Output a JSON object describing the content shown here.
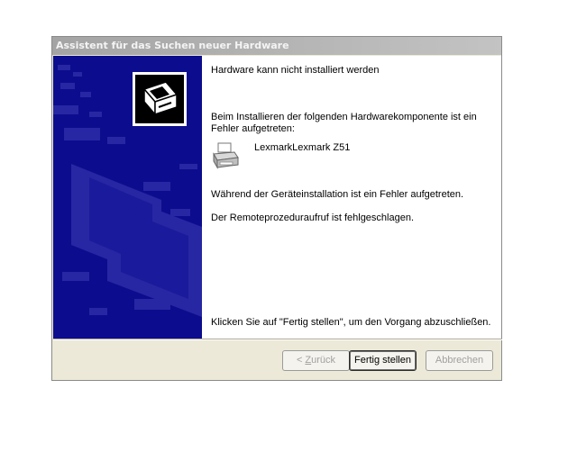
{
  "window": {
    "title": "Assistent für das Suchen neuer Hardware"
  },
  "sidebar": {
    "icon": "hardware-wizard-icon",
    "color": "#0c0c8e"
  },
  "content": {
    "heading": "Hardware kann nicht installiert werden",
    "intro": "Beim Installieren der folgenden Hardwarekomponente ist ein Fehler aufgetreten:",
    "device_icon": "printer-icon",
    "device_name": "LexmarkLexmark Z51",
    "message_1": "Während der Geräteinstallation ist ein Fehler aufgetreten.",
    "message_2": "Der Remoteprozeduraufruf ist fehlgeschlagen.",
    "finish_note": "Klicken Sie auf \"Fertig stellen\", um den Vorgang abzuschließen."
  },
  "buttons": {
    "back_prefix": "< ",
    "back_hotkey": "Z",
    "back_rest": "urück",
    "finish": "Fertig stellen",
    "cancel": "Abbrechen"
  }
}
